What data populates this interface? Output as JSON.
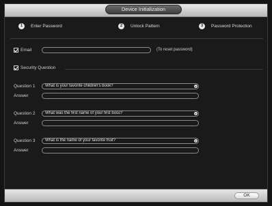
{
  "window": {
    "title": "Device Initialization"
  },
  "steps": [
    {
      "number": "1",
      "label": "Enter Password"
    },
    {
      "number": "2",
      "label": "Unlock Pattern"
    },
    {
      "number": "3",
      "label": "Password Protection"
    }
  ],
  "email": {
    "label": "Email",
    "value": "",
    "hint": "(To reset password)"
  },
  "security": {
    "label": "Security Question",
    "questions": [
      {
        "label": "Question 1",
        "value": "What is your favorite children's book?",
        "answer_label": "Answer",
        "answer_value": ""
      },
      {
        "label": "Question 2",
        "value": "What was the first name of your first boss?",
        "answer_label": "Answer",
        "answer_value": ""
      },
      {
        "label": "Question 3",
        "value": "What is the name of your favorite fruit?",
        "answer_label": "Answer",
        "answer_value": ""
      }
    ]
  },
  "footer": {
    "ok_label": "OK"
  },
  "colors": {
    "background": "#1a1a1a",
    "bar": "#d0d0d0",
    "border": "#8c8c8c"
  }
}
